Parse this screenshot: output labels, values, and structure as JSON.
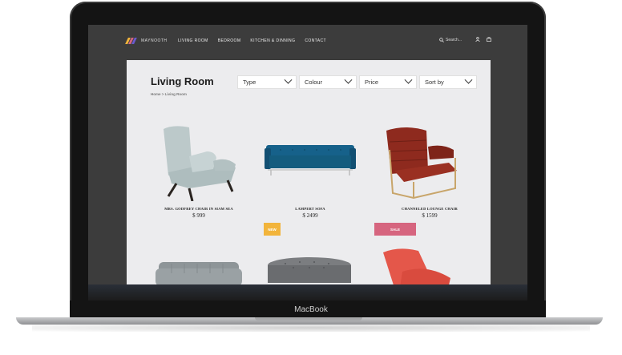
{
  "site": {
    "logo_text": "MAYNOOTH",
    "nav": [
      "LIVING ROOM",
      "BEDROOM",
      "KITCHEN & DINNING",
      "CONTACT"
    ],
    "search_placeholder": "Search...",
    "icons": [
      "search-icon",
      "user-icon",
      "bag-icon"
    ]
  },
  "page": {
    "title": "Living Room",
    "breadcrumb": "Home > Living Room",
    "filters": [
      "Type",
      "Colour",
      "Price",
      "Sort by"
    ]
  },
  "products": [
    {
      "name": "MRS. GODFREY CHAIR IN SIAM SEA",
      "price": "$ 999",
      "color": "#b9c6c7"
    },
    {
      "name": "LAMPERT SOFA",
      "price": "$ 2499",
      "color": "#145c7e"
    },
    {
      "name": "CHANNELED LOUNGE CHAIR",
      "price": "$ 1599",
      "color": "#8e2a1e"
    }
  ],
  "badges": {
    "new": "NEW",
    "sale": "SALE"
  },
  "colors": {
    "badge_new": "#f2b43b",
    "badge_sale": "#d6657f"
  },
  "device_label": "MacBook"
}
